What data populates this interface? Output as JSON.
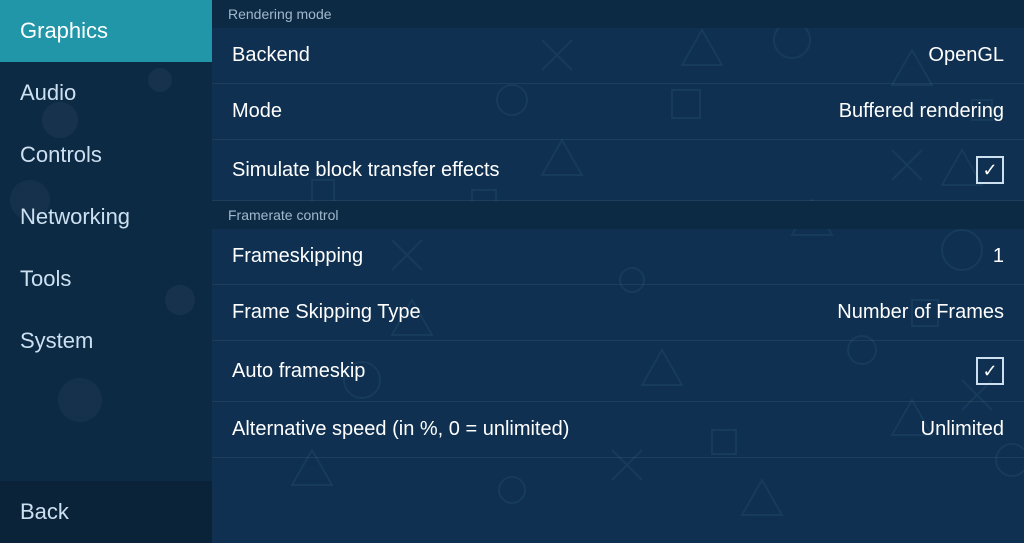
{
  "sidebar": {
    "items": [
      {
        "label": "Graphics",
        "active": true
      },
      {
        "label": "Audio",
        "active": false
      },
      {
        "label": "Controls",
        "active": false
      },
      {
        "label": "Networking",
        "active": false
      },
      {
        "label": "Tools",
        "active": false
      },
      {
        "label": "System",
        "active": false
      }
    ],
    "back_label": "Back"
  },
  "main": {
    "sections": [
      {
        "header": "Rendering mode",
        "rows": [
          {
            "label": "Backend",
            "value": "OpenGL",
            "type": "text"
          },
          {
            "label": "Mode",
            "value": "Buffered rendering",
            "type": "text"
          },
          {
            "label": "Simulate block transfer effects",
            "value": "☑",
            "type": "checkbox"
          }
        ]
      },
      {
        "header": "Framerate control",
        "rows": [
          {
            "label": "Frameskipping",
            "value": "1",
            "type": "text"
          },
          {
            "label": "Frame Skipping Type",
            "value": "Number of Frames",
            "type": "text"
          },
          {
            "label": "Auto frameskip",
            "value": "☑",
            "type": "checkbox"
          },
          {
            "label": "Alternative speed (in %, 0 = unlimited)",
            "value": "Unlimited",
            "type": "text"
          }
        ]
      }
    ]
  }
}
